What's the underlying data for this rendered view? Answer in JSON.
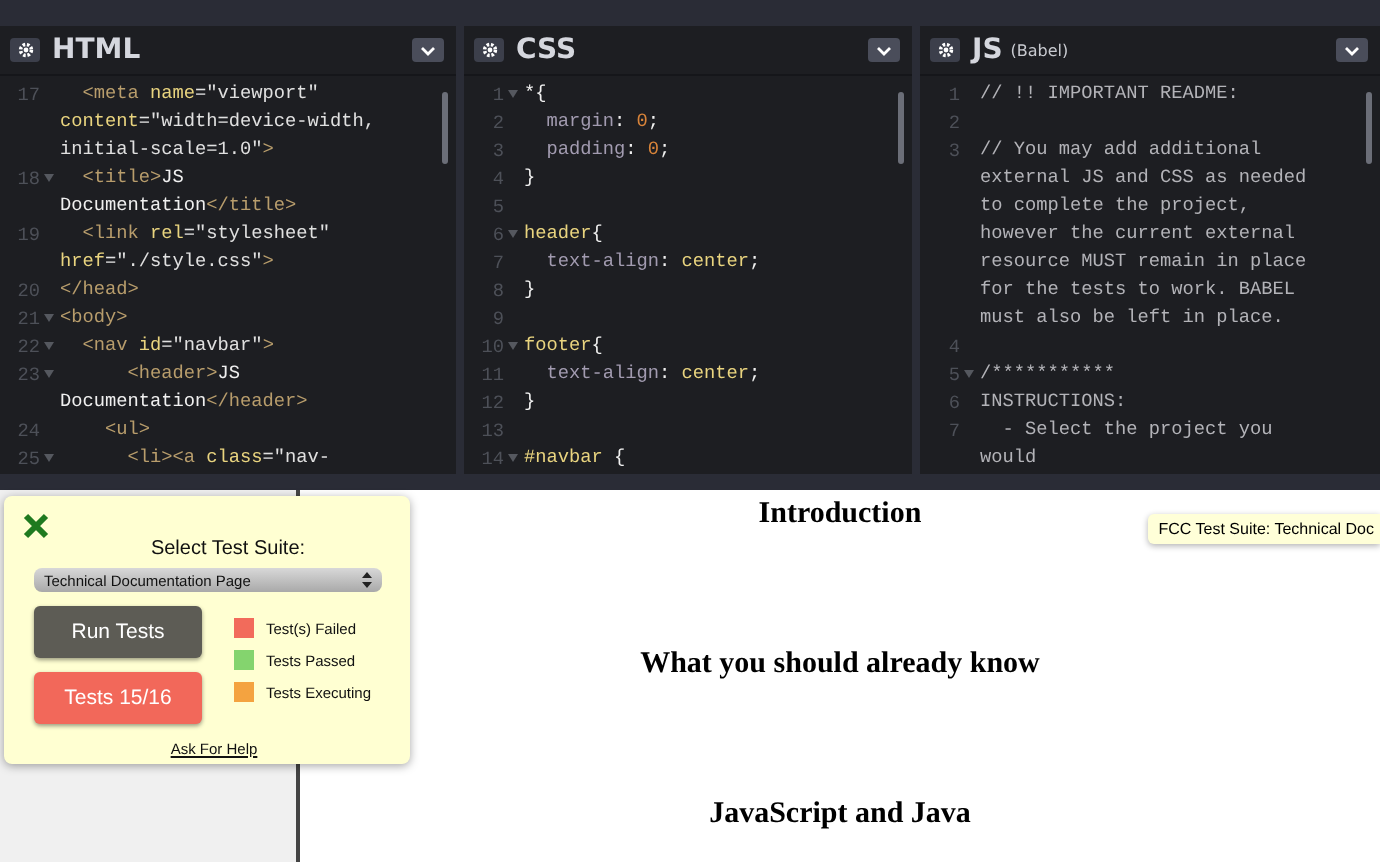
{
  "editors": [
    {
      "title": "HTML",
      "lines": [
        {
          "number": "17",
          "fold": false,
          "rows": [
            {
              "tokens": [
                {
                  "kind": "tag",
                  "text": "  <meta "
                },
                {
                  "kind": "attr",
                  "text": "name"
                },
                {
                  "kind": "punct",
                  "text": "="
                },
                {
                  "kind": "string",
                  "text": "\"viewport\""
                }
              ]
            },
            {
              "tokens": [
                {
                  "kind": "attr",
                  "text": "content"
                },
                {
                  "kind": "punct",
                  "text": "="
                },
                {
                  "kind": "string",
                  "text": "\"width=device-width,"
                }
              ]
            },
            {
              "tokens": [
                {
                  "kind": "string",
                  "text": "initial-scale=1.0\""
                },
                {
                  "kind": "tag",
                  "text": ">"
                }
              ]
            }
          ]
        },
        {
          "number": "18",
          "fold": true,
          "rows": [
            {
              "tokens": [
                {
                  "kind": "tag",
                  "text": "  <title>"
                },
                {
                  "kind": "text",
                  "text": "JS"
                }
              ]
            },
            {
              "tokens": [
                {
                  "kind": "text",
                  "text": "Documentation"
                },
                {
                  "kind": "tag",
                  "text": "</title>"
                }
              ]
            }
          ]
        },
        {
          "number": "19",
          "fold": false,
          "rows": [
            {
              "tokens": [
                {
                  "kind": "tag",
                  "text": "  <link "
                },
                {
                  "kind": "attr",
                  "text": "rel"
                },
                {
                  "kind": "punct",
                  "text": "="
                },
                {
                  "kind": "string",
                  "text": "\"stylesheet\""
                }
              ]
            },
            {
              "tokens": [
                {
                  "kind": "attr",
                  "text": "href"
                },
                {
                  "kind": "punct",
                  "text": "="
                },
                {
                  "kind": "string",
                  "text": "\"./style.css\""
                },
                {
                  "kind": "tag",
                  "text": ">"
                }
              ]
            }
          ]
        },
        {
          "number": "20",
          "fold": false,
          "rows": [
            {
              "tokens": [
                {
                  "kind": "tag",
                  "text": "</head>"
                }
              ]
            }
          ]
        },
        {
          "number": "21",
          "fold": true,
          "rows": [
            {
              "tokens": [
                {
                  "kind": "tag",
                  "text": "<body>"
                }
              ]
            }
          ]
        },
        {
          "number": "22",
          "fold": true,
          "rows": [
            {
              "tokens": [
                {
                  "kind": "tag",
                  "text": "  <nav "
                },
                {
                  "kind": "attr",
                  "text": "id"
                },
                {
                  "kind": "punct",
                  "text": "="
                },
                {
                  "kind": "string",
                  "text": "\"navbar\""
                },
                {
                  "kind": "tag",
                  "text": ">"
                }
              ]
            }
          ]
        },
        {
          "number": "23",
          "fold": true,
          "rows": [
            {
              "tokens": [
                {
                  "kind": "tag",
                  "text": "      <header>"
                },
                {
                  "kind": "text",
                  "text": "JS"
                }
              ]
            },
            {
              "tokens": [
                {
                  "kind": "text",
                  "text": "Documentation"
                },
                {
                  "kind": "tag",
                  "text": "</header>"
                }
              ]
            }
          ]
        },
        {
          "number": "24",
          "fold": false,
          "rows": [
            {
              "tokens": [
                {
                  "kind": "tag",
                  "text": "    <ul>"
                }
              ]
            }
          ]
        },
        {
          "number": "25",
          "fold": true,
          "rows": [
            {
              "tokens": [
                {
                  "kind": "tag",
                  "text": "      <li><a "
                },
                {
                  "kind": "attr",
                  "text": "class"
                },
                {
                  "kind": "punct",
                  "text": "="
                },
                {
                  "kind": "string",
                  "text": "\"nav-"
                }
              ]
            }
          ]
        }
      ]
    },
    {
      "title": "CSS",
      "lines": [
        {
          "number": "1",
          "fold": true,
          "rows": [
            {
              "tokens": [
                {
                  "kind": "text",
                  "text": "*{"
                }
              ]
            }
          ]
        },
        {
          "number": "2",
          "fold": false,
          "rows": [
            {
              "tokens": [
                {
                  "kind": "prop",
                  "text": "  margin"
                },
                {
                  "kind": "text",
                  "text": ": "
                },
                {
                  "kind": "num",
                  "text": "0"
                },
                {
                  "kind": "text",
                  "text": ";"
                }
              ]
            }
          ]
        },
        {
          "number": "3",
          "fold": false,
          "rows": [
            {
              "tokens": [
                {
                  "kind": "prop",
                  "text": "  padding"
                },
                {
                  "kind": "text",
                  "text": ": "
                },
                {
                  "kind": "num",
                  "text": "0"
                },
                {
                  "kind": "text",
                  "text": ";"
                }
              ]
            }
          ]
        },
        {
          "number": "4",
          "fold": false,
          "rows": [
            {
              "tokens": [
                {
                  "kind": "text",
                  "text": "}"
                }
              ]
            }
          ]
        },
        {
          "number": "5",
          "fold": false
        },
        {
          "number": "6",
          "fold": true,
          "rows": [
            {
              "tokens": [
                {
                  "kind": "selector",
                  "text": "header"
                },
                {
                  "kind": "text",
                  "text": "{"
                }
              ]
            }
          ]
        },
        {
          "number": "7",
          "fold": false,
          "rows": [
            {
              "tokens": [
                {
                  "kind": "prop",
                  "text": "  text-align"
                },
                {
                  "kind": "text",
                  "text": ": "
                },
                {
                  "kind": "selector",
                  "text": "center"
                },
                {
                  "kind": "text",
                  "text": ";"
                }
              ]
            }
          ]
        },
        {
          "number": "8",
          "fold": false,
          "rows": [
            {
              "tokens": [
                {
                  "kind": "text",
                  "text": "}"
                }
              ]
            }
          ]
        },
        {
          "number": "9",
          "fold": false
        },
        {
          "number": "10",
          "fold": true,
          "rows": [
            {
              "tokens": [
                {
                  "kind": "selector",
                  "text": "footer"
                },
                {
                  "kind": "text",
                  "text": "{"
                }
              ]
            }
          ]
        },
        {
          "number": "11",
          "fold": false,
          "rows": [
            {
              "tokens": [
                {
                  "kind": "prop",
                  "text": "  text-align"
                },
                {
                  "kind": "text",
                  "text": ": "
                },
                {
                  "kind": "selector",
                  "text": "center"
                },
                {
                  "kind": "text",
                  "text": ";"
                }
              ]
            }
          ]
        },
        {
          "number": "12",
          "fold": false,
          "rows": [
            {
              "tokens": [
                {
                  "kind": "text",
                  "text": "}"
                }
              ]
            }
          ]
        },
        {
          "number": "13",
          "fold": false
        },
        {
          "number": "14",
          "fold": true,
          "rows": [
            {
              "tokens": [
                {
                  "kind": "selector",
                  "text": "#navbar"
                },
                {
                  "kind": "text",
                  "text": " {"
                }
              ]
            }
          ]
        }
      ]
    },
    {
      "title": "JS",
      "subtitle": "(Babel)",
      "lines": [
        {
          "number": "1",
          "fold": false,
          "rows": [
            {
              "tokens": [
                {
                  "kind": "comment",
                  "text": "// !! IMPORTANT README:"
                }
              ]
            }
          ]
        },
        {
          "number": "2",
          "fold": false
        },
        {
          "number": "3",
          "fold": false,
          "rows": [
            {
              "tokens": [
                {
                  "kind": "comment",
                  "text": "// You may add additional"
                }
              ]
            },
            {
              "tokens": [
                {
                  "kind": "comment",
                  "text": "external JS and CSS as needed"
                }
              ]
            },
            {
              "tokens": [
                {
                  "kind": "comment",
                  "text": "to complete the project,"
                }
              ]
            },
            {
              "tokens": [
                {
                  "kind": "comment",
                  "text": "however the current external"
                }
              ]
            },
            {
              "tokens": [
                {
                  "kind": "comment",
                  "text": "resource MUST remain in place"
                }
              ]
            },
            {
              "tokens": [
                {
                  "kind": "comment",
                  "text": "for the tests to work. BABEL"
                }
              ]
            },
            {
              "tokens": [
                {
                  "kind": "comment",
                  "text": "must also be left in place."
                }
              ]
            }
          ]
        },
        {
          "number": "4",
          "fold": false
        },
        {
          "number": "5",
          "fold": true,
          "rows": [
            {
              "tokens": [
                {
                  "kind": "comment",
                  "text": "/***********"
                }
              ]
            }
          ]
        },
        {
          "number": "6",
          "fold": false,
          "rows": [
            {
              "tokens": [
                {
                  "kind": "comment",
                  "text": "INSTRUCTIONS:"
                }
              ]
            }
          ]
        },
        {
          "number": "7",
          "fold": false,
          "rows": [
            {
              "tokens": [
                {
                  "kind": "comment",
                  "text": "  - Select the project you"
                }
              ]
            },
            {
              "tokens": [
                {
                  "kind": "comment",
                  "text": "would"
                }
              ]
            }
          ]
        }
      ]
    }
  ],
  "preview": {
    "headings": [
      "Introduction",
      "What you should already know",
      "JavaScript and Java"
    ],
    "tooltip": "FCC Test Suite: Technical Doc"
  },
  "test_panel": {
    "title": "Select Test Suite:",
    "suite": "Technical Documentation Page",
    "buttons": [
      {
        "label": "Run Tests",
        "kind": "run"
      },
      {
        "label": "Tests 15/16",
        "kind": "failed"
      }
    ],
    "legend": [
      {
        "label": "Test(s) Failed",
        "color": "#f26b5b"
      },
      {
        "label": "Tests Passed",
        "color": "#84d46e"
      },
      {
        "label": "Tests Executing",
        "color": "#f4a340"
      }
    ],
    "help_link": "Ask For Help"
  }
}
